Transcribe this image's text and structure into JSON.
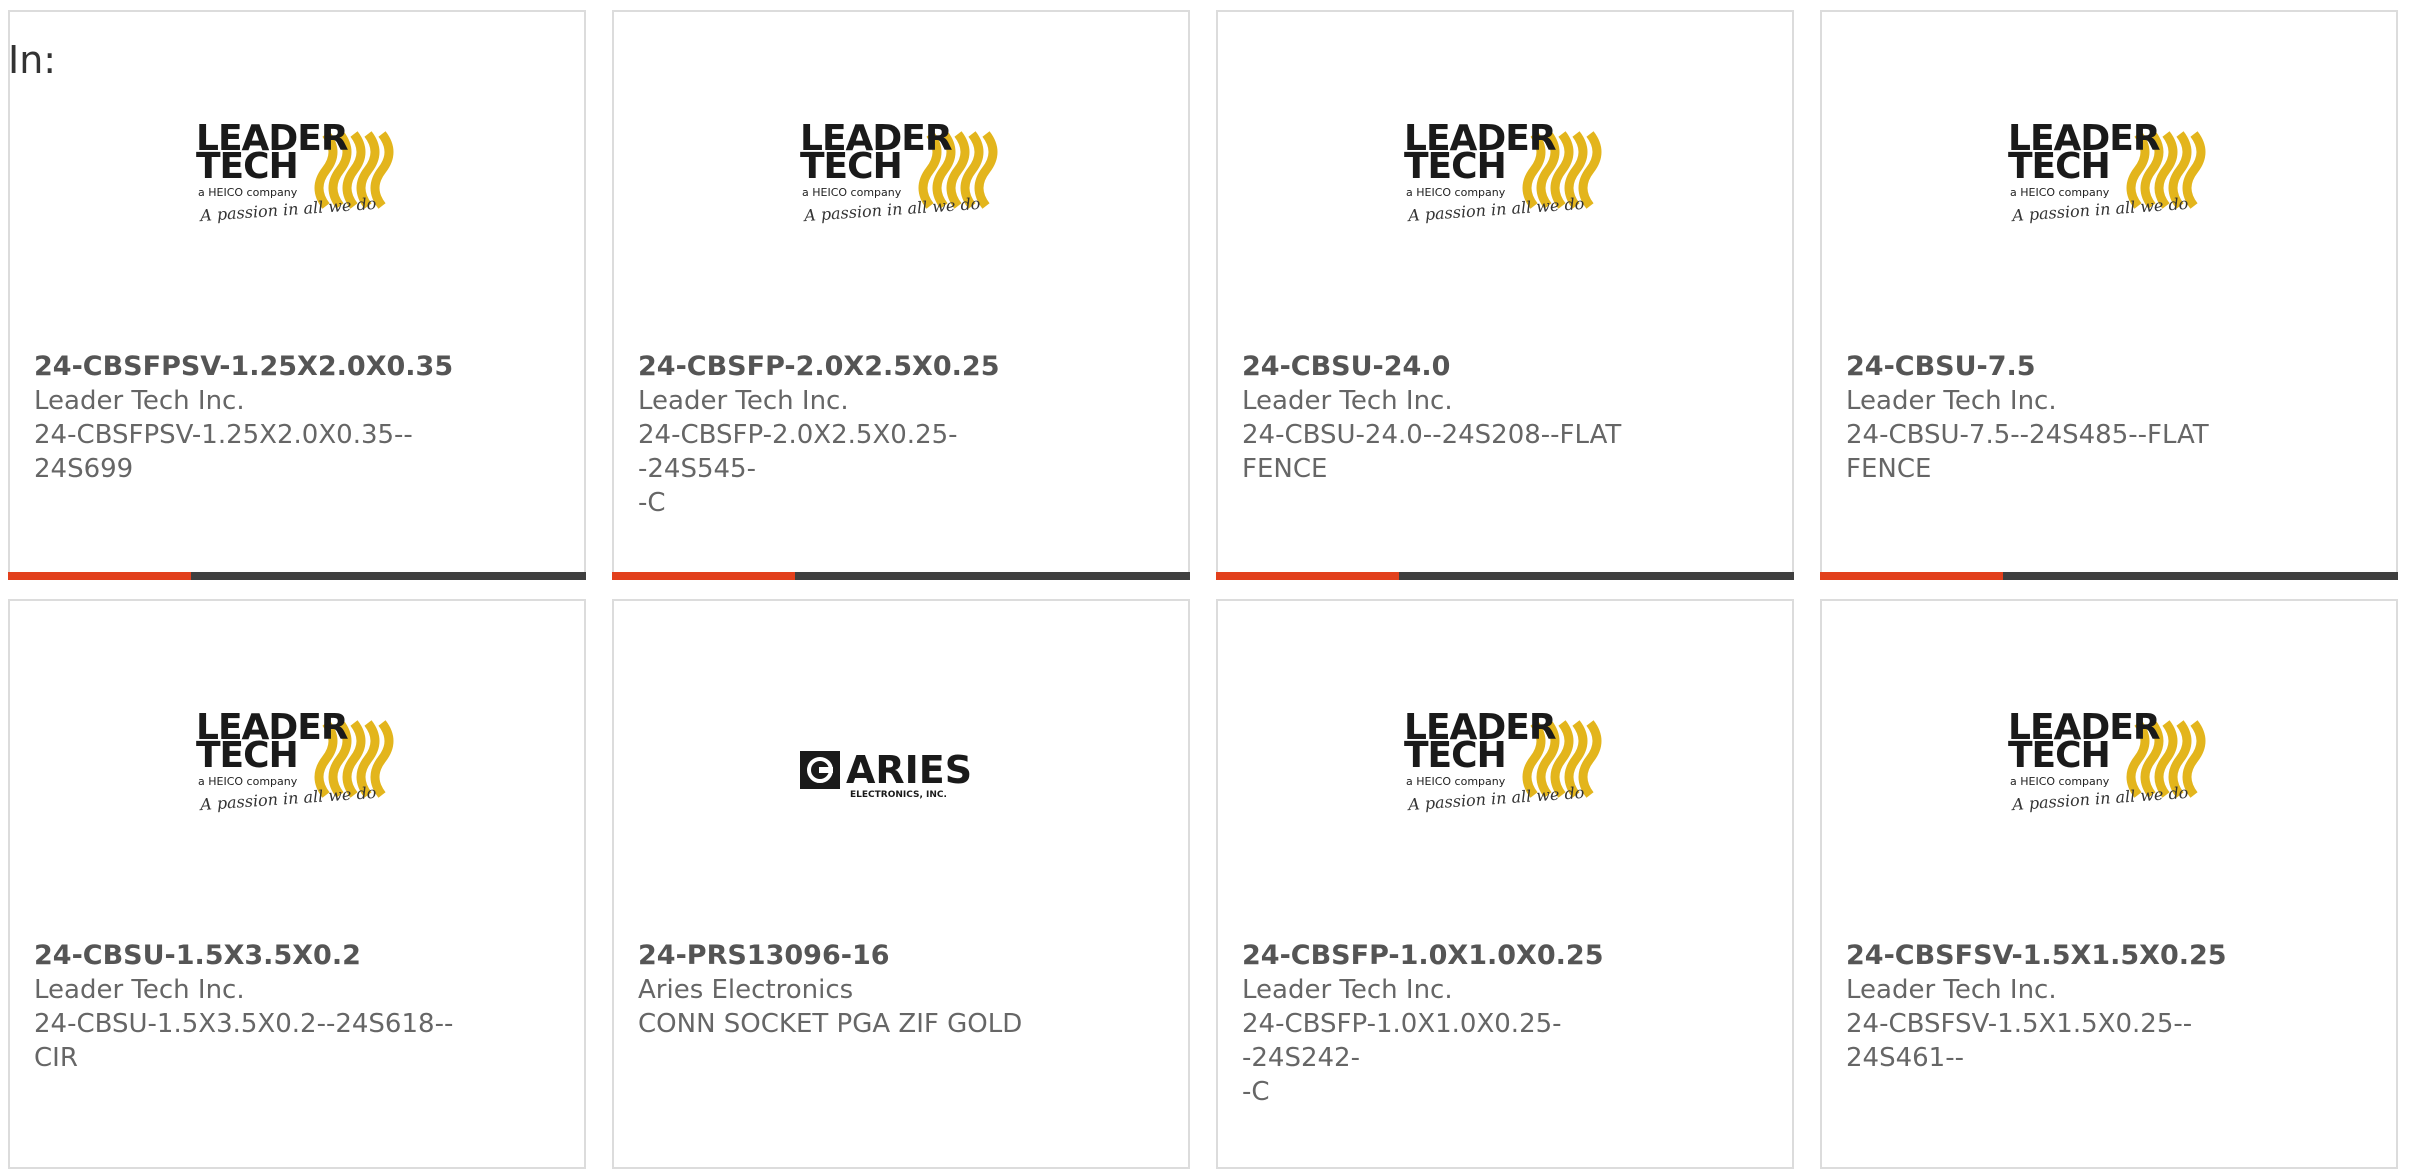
{
  "header": {
    "in_label": "In:"
  },
  "logos": {
    "leader_tech": {
      "line1": "LEADER",
      "line2": "TECH",
      "sub": "a HEICO company",
      "tagline": "A passion in all we do"
    },
    "aries": {
      "word": "ARIES",
      "sub": "ELECTRONICS, INC."
    }
  },
  "products": [
    {
      "part": "24-CBSFPSV-1.25X2.0X0.35",
      "maker": "Leader Tech Inc.",
      "desc_line1": "24-CBSFPSV-1.25X2.0X0.35--",
      "desc_line2": "24S699",
      "logo": "leader-tech-logo"
    },
    {
      "part": "24-CBSFP-2.0X2.5X0.25",
      "maker": "Leader Tech Inc.",
      "desc_line1": "24-CBSFP-2.0X2.5X0.25--24S545-",
      "desc_line2": "-C",
      "logo": "leader-tech-logo"
    },
    {
      "part": "24-CBSU-24.0",
      "maker": "Leader Tech Inc.",
      "desc_line1": "24-CBSU-24.0--24S208--FLAT",
      "desc_line2": "FENCE",
      "logo": "leader-tech-logo"
    },
    {
      "part": "24-CBSU-7.5",
      "maker": "Leader Tech Inc.",
      "desc_line1": "24-CBSU-7.5--24S485--FLAT",
      "desc_line2": "FENCE",
      "logo": "leader-tech-logo"
    },
    {
      "part": "24-CBSU-1.5X3.5X0.2",
      "maker": "Leader Tech Inc.",
      "desc_line1": "24-CBSU-1.5X3.5X0.2--24S618--",
      "desc_line2": "CIR",
      "logo": "leader-tech-logo"
    },
    {
      "part": "24-PRS13096-16",
      "maker": "Aries Electronics",
      "desc_line1": "CONN SOCKET PGA ZIF GOLD",
      "desc_line2": "",
      "logo": "aries-logo"
    },
    {
      "part": "24-CBSFP-1.0X1.0X0.25",
      "maker": "Leader Tech Inc.",
      "desc_line1": "24-CBSFP-1.0X1.0X0.25--24S242-",
      "desc_line2": "-C",
      "logo": "leader-tech-logo"
    },
    {
      "part": "24-CBSFSV-1.5X1.5X0.25",
      "maker": "Leader Tech Inc.",
      "desc_line1": "24-CBSFSV-1.5X1.5X0.25--",
      "desc_line2": "24S461--",
      "logo": "leader-tech-logo"
    }
  ],
  "colors": {
    "accent": "#e2401c",
    "bar": "#3f3f3f",
    "logo_yellow": "#e3b51c"
  }
}
